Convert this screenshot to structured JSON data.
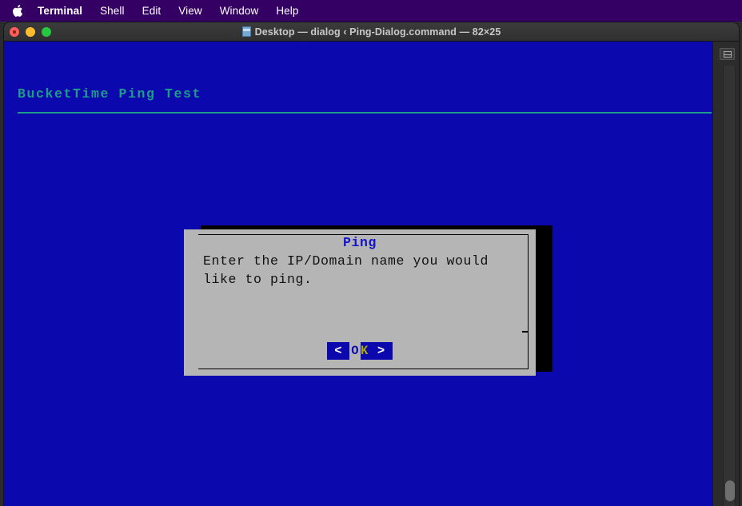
{
  "menubar": {
    "apple_icon": "apple-logo-icon",
    "items": [
      {
        "label": "Terminal",
        "bold": true
      },
      {
        "label": "Shell",
        "bold": false
      },
      {
        "label": "Edit",
        "bold": false
      },
      {
        "label": "View",
        "bold": false
      },
      {
        "label": "Window",
        "bold": false
      },
      {
        "label": "Help",
        "bold": false
      }
    ]
  },
  "window": {
    "title": "Desktop — dialog ‹ Ping-Dialog.command — 82×25",
    "doc_icon": "document-icon",
    "traffic_lights": {
      "close": "close-button",
      "minimize": "minimize-button",
      "zoom": "zoom-button"
    }
  },
  "terminal": {
    "header_text": "BucketTime Ping Test",
    "background_color": "#0b09ad",
    "header_color": "#1f9b8a",
    "split_button_icon": "split-pane-icon"
  },
  "dialog": {
    "title": "Ping",
    "title_color": "#1414c8",
    "background_color": "#b5b5b5",
    "message_line1": "Enter the IP/Domain name you would",
    "message_line2": "like to ping.",
    "button": {
      "left_bracket": "<",
      "hotkey": "O",
      "rest": "K",
      "right_bracket": ">",
      "background_color": "#0b09ad",
      "hotkey_color": "#0b09ad",
      "rest_color": "#a9a90d"
    }
  }
}
